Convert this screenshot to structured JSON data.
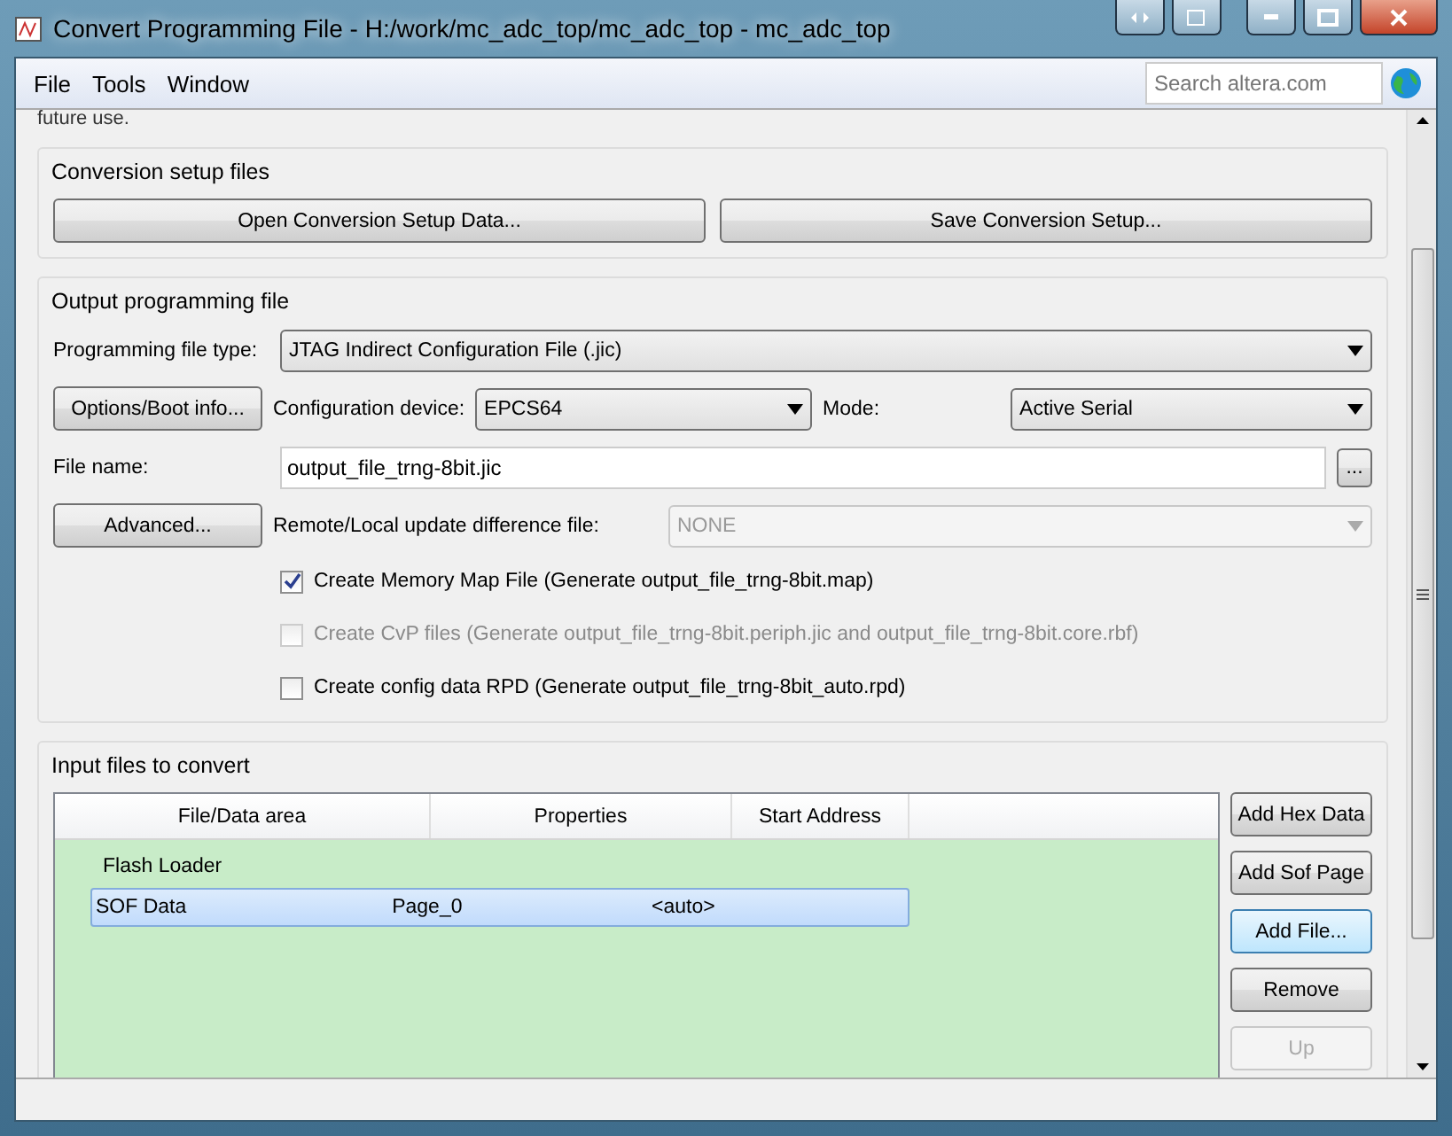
{
  "window": {
    "title": "Convert Programming File - H:/work/mc_adc_top/mc_adc_top - mc_adc_top"
  },
  "menu": [
    "File",
    "Tools",
    "Window"
  ],
  "search": {
    "placeholder": "Search altera.com"
  },
  "clipped_text": "future use.",
  "conversion_setup": {
    "title": "Conversion setup files",
    "buttons": [
      "Open Conversion Setup Data...",
      "Save Conversion Setup..."
    ]
  },
  "output": {
    "title": "Output programming file",
    "file_type_label": "Programming file type:",
    "file_type": "JTAG Indirect Configuration File (.jic)",
    "options_button": "Options/Boot info...",
    "device_label": "Configuration device:",
    "device": "EPCS64",
    "mode_label": "Mode:",
    "mode": "Active Serial",
    "file_name_label": "File name:",
    "file_name": "output_file_trng-8bit.jic",
    "browse_button": "...",
    "advanced_button": "Advanced...",
    "remote_label": "Remote/Local update difference file:",
    "remote": {
      "value": "NONE",
      "disabled": true
    },
    "checkboxes": [
      {
        "label": "Create Memory Map File (Generate output_file_trng-8bit.map)",
        "checked": true,
        "disabled": false
      },
      {
        "label": "Create CvP files (Generate output_file_trng-8bit.periph.jic and output_file_trng-8bit.core.rbf)",
        "checked": false,
        "disabled": true
      },
      {
        "label": "Create config data RPD (Generate output_file_trng-8bit_auto.rpd)",
        "checked": false,
        "disabled": false
      }
    ]
  },
  "input": {
    "title": "Input files to convert",
    "columns": [
      "File/Data area",
      "Properties",
      "Start Address"
    ],
    "rows": [
      {
        "cells": [
          "Flash Loader"
        ],
        "selected": false
      },
      {
        "cells": [
          "SOF Data",
          "Page_0",
          "<auto>"
        ],
        "selected": true
      }
    ],
    "buttons": [
      {
        "label": "Add Hex Data",
        "disabled": false,
        "focused": false
      },
      {
        "label": "Add Sof Page",
        "disabled": false,
        "focused": false
      },
      {
        "label": "Add File...",
        "disabled": false,
        "focused": true
      },
      {
        "label": "Remove",
        "disabled": false,
        "focused": false
      },
      {
        "label": "Up",
        "disabled": true,
        "focused": false
      }
    ]
  }
}
